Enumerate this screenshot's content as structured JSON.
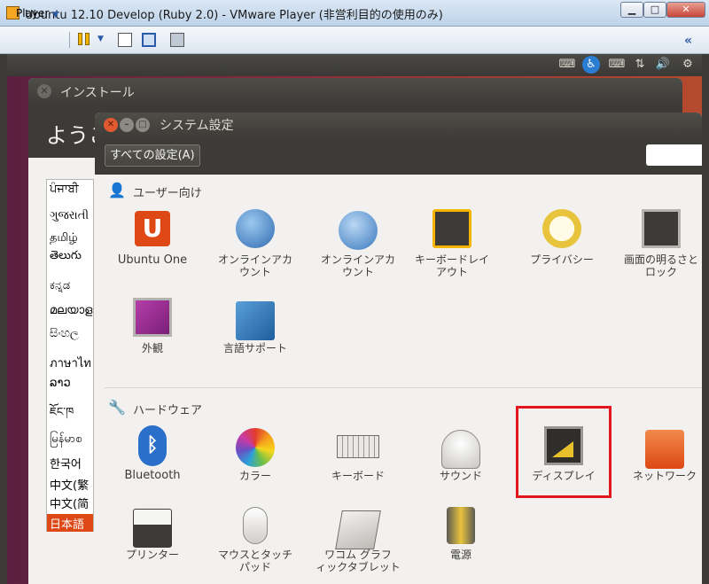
{
  "window": {
    "title": "Ubuntu 12.10 Develop (Ruby 2.0) - VMware Player (非営利目的の使用のみ)",
    "controls": [
      "minimize",
      "maximize",
      "close"
    ]
  },
  "vmware_toolbar": {
    "player_label": "Player",
    "collapse_label": "«"
  },
  "ubuntu_panel": {
    "icons": [
      "keyboard-icon",
      "accessibility-icon",
      "keyboard-layout-icon",
      "network-icon",
      "volume-icon",
      "gear-icon"
    ]
  },
  "installer": {
    "title": "インストール",
    "welcome": "ようこ",
    "languages": [
      "ਪੰਜਾਬੀ",
      "ગુજરાતી",
      "தமிழ்",
      "తెలుగు",
      "ಕನ್ನಡ",
      "മലയാളം",
      "සිංහල",
      "ภาษาไท",
      "ລາວ",
      "ཇོང་ཁ",
      "မြန်မာစ",
      "한국어",
      "中文(繁",
      "中文(简",
      "日本語"
    ],
    "selected_language": "日本語"
  },
  "settings": {
    "title": "システム設定",
    "all_settings_label": "すべての設定(A)",
    "section_personal": "ユーザー向け",
    "section_hardware": "ハードウェア",
    "personal_items": [
      {
        "label": "Ubuntu One",
        "icon": "ubuntu-one-icon"
      },
      {
        "label": "オンラインアカ\nウント",
        "icon": "online-accounts-icon"
      },
      {
        "label": "オンラインアカ\nウント",
        "icon": "online-accounts-icon"
      },
      {
        "label": "キーボードレイ\nアウト",
        "icon": "keyboard-layout-icon"
      },
      {
        "label": "プライバシー",
        "icon": "privacy-icon"
      },
      {
        "label": "画面の明るさと\nロック",
        "icon": "brightness-lock-icon"
      },
      {
        "label": "外観",
        "icon": "appearance-icon"
      },
      {
        "label": "言語サポート",
        "icon": "language-support-icon"
      }
    ],
    "hardware_items": [
      {
        "label": "Bluetooth",
        "icon": "bluetooth-icon"
      },
      {
        "label": "カラー",
        "icon": "color-icon"
      },
      {
        "label": "キーボード",
        "icon": "keyboard-icon"
      },
      {
        "label": "サウンド",
        "icon": "sound-icon"
      },
      {
        "label": "ディスプレイ",
        "icon": "display-icon"
      },
      {
        "label": "ネットワーク",
        "icon": "network-icon"
      },
      {
        "label": "プリンター",
        "icon": "printer-icon"
      },
      {
        "label": "マウスとタッチ\nパッド",
        "icon": "mouse-touchpad-icon"
      },
      {
        "label": "ワコム グラフ\nィックタブレット",
        "icon": "wacom-tablet-icon"
      },
      {
        "label": "電源",
        "icon": "power-icon"
      }
    ]
  },
  "colors": {
    "ubuntu_orange": "#dd4814",
    "highlight": "#e2161c",
    "panel_dark": "#3c3b37"
  }
}
